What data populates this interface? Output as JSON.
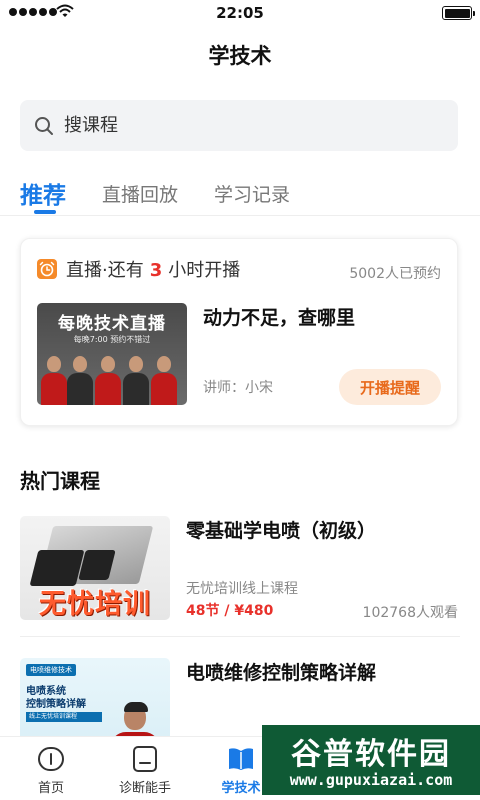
{
  "status_bar": {
    "time": "22:05"
  },
  "header": {
    "title": "学技术"
  },
  "search": {
    "placeholder": "搜课程"
  },
  "tabs": [
    {
      "label": "推荐",
      "active": true
    },
    {
      "label": "直播回放",
      "active": false
    },
    {
      "label": "学习记录",
      "active": false
    }
  ],
  "live": {
    "status_prefix": "直播·还有",
    "hours": "3",
    "status_suffix": "小时开播",
    "reserved": "5002人已预约",
    "thumb_title": "每晚技术直播",
    "thumb_subtitle": "每晚7:00  预约不错过",
    "title": "动力不足，查哪里",
    "lecturer": "讲师：小宋",
    "remind_button": "开播提醒"
  },
  "hot_courses": {
    "title": "热门课程",
    "items": [
      {
        "name": "零基础学电喷（初级）",
        "thumb_text": "无忧培训",
        "provider": "无忧培训线上课程",
        "price": "48节 / ¥480",
        "views": "102768人观看"
      },
      {
        "name": "电喷维修控制策略详解",
        "thumb_tag": "电喷维修技术",
        "thumb_line1": "电喷系统",
        "thumb_line2": "控制策略详解",
        "thumb_bar": "线上无忧培训课程"
      }
    ]
  },
  "tabbar": [
    {
      "label": "首页",
      "icon": "home-icon",
      "active": false
    },
    {
      "label": "诊断能手",
      "icon": "diagnose-icon",
      "active": false
    },
    {
      "label": "学技术",
      "icon": "book-icon",
      "active": true
    }
  ],
  "watermark": {
    "text": "谷普软件园",
    "url": "www.gupuxiazai.com"
  },
  "colors": {
    "accent": "#1a7ae6",
    "price": "#e8312b",
    "remind_bg": "#fdebdc",
    "remind_text": "#e86a1c"
  }
}
